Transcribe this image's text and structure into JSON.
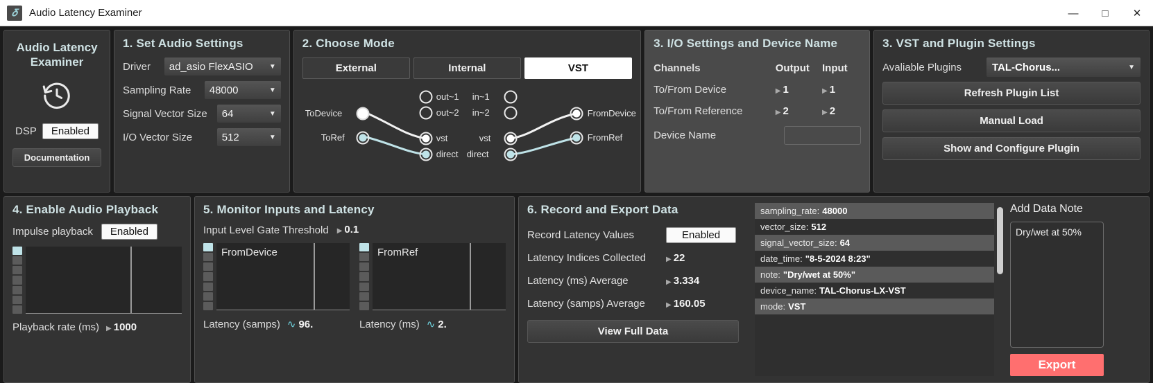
{
  "window": {
    "title": "Audio Latency Examiner",
    "icon": "app-icon",
    "minimize": "—",
    "maximize": "□",
    "close": "✕"
  },
  "brand": {
    "title": "Audio Latency Examiner",
    "icon": "history-clock-icon",
    "dsp_label": "DSP",
    "dsp_value": "Enabled",
    "documentation": "Documentation"
  },
  "audio_settings": {
    "title": "1. Set Audio Settings",
    "rows": [
      {
        "label": "Driver",
        "value": "ad_asio FlexASIO"
      },
      {
        "label": "Sampling Rate",
        "value": "48000"
      },
      {
        "label": "Signal Vector Size",
        "value": "64"
      },
      {
        "label": "I/O Vector Size",
        "value": "512"
      }
    ]
  },
  "mode": {
    "title": "2. Choose Mode",
    "buttons": [
      {
        "label": "External",
        "active": false
      },
      {
        "label": "Internal",
        "active": false
      },
      {
        "label": "VST",
        "active": true
      }
    ],
    "routing": {
      "left_nodes": [
        {
          "label": "ToDevice",
          "filled": "white"
        },
        {
          "label": "ToRef",
          "filled": "cyan"
        }
      ],
      "out_nodes": [
        {
          "label": "out~1",
          "filled": "none"
        },
        {
          "label": "out~2",
          "filled": "none"
        },
        {
          "label": "vst",
          "filled": "white"
        },
        {
          "label": "direct",
          "filled": "cyan"
        }
      ],
      "in_nodes": [
        {
          "label": "in~1",
          "filled": "none"
        },
        {
          "label": "in~2",
          "filled": "none"
        },
        {
          "label": "vst",
          "filled": "white"
        },
        {
          "label": "direct",
          "filled": "cyan"
        }
      ],
      "right_nodes": [
        {
          "label": "FromDevice",
          "filled": "white"
        },
        {
          "label": "FromRef",
          "filled": "cyan"
        }
      ]
    }
  },
  "io_settings": {
    "title": "3. I/O Settings and Device Name",
    "headers": {
      "channels": "Channels",
      "output": "Output",
      "input": "Input"
    },
    "rows": [
      {
        "label": "To/From Device",
        "output": "1",
        "input": "1"
      },
      {
        "label": "To/From Reference",
        "output": "2",
        "input": "2"
      }
    ],
    "device_name_label": "Device Name",
    "device_name_value": ""
  },
  "vst_settings": {
    "title": "3. VST and Plugin Settings",
    "plugins_label": "Avaliable Plugins",
    "plugins_value": "TAL-Chorus...",
    "buttons": [
      "Refresh Plugin List",
      "Manual Load",
      "Show and Configure Plugin"
    ]
  },
  "playback": {
    "title": "4. Enable Audio Playback",
    "impulse_label": "Impulse playback",
    "impulse_value": "Enabled",
    "rate_label": "Playback rate (ms)",
    "rate_value": "1000"
  },
  "monitor": {
    "title": "5. Monitor Inputs and Latency",
    "gate_label": "Input Level Gate Threshold",
    "gate_value": "0.1",
    "scopes": [
      {
        "name": "FromDevice",
        "foot_label": "Latency (samps)",
        "foot_value": "96."
      },
      {
        "name": "FromRef",
        "foot_label": "Latency (ms)",
        "foot_value": "2."
      }
    ]
  },
  "record": {
    "title": "6. Record and Export Data",
    "rows": [
      {
        "label": "Record Latency Values",
        "value": "Enabled",
        "type": "toggle"
      },
      {
        "label": "Latency Indices Collected",
        "value": "22",
        "type": "number"
      },
      {
        "label": "Latency (ms) Average",
        "value": "3.334",
        "type": "number"
      },
      {
        "label": "Latency (samps) Average",
        "value": "160.05",
        "type": "number"
      }
    ],
    "view_full_data": "View Full Data",
    "data_list": [
      {
        "key": "sampling_rate:",
        "value": "48000"
      },
      {
        "key": "vector_size:",
        "value": "512"
      },
      {
        "key": "signal_vector_size:",
        "value": "64"
      },
      {
        "key": "date_time:",
        "value": "\"8-5-2024 8:23\""
      },
      {
        "key": "note:",
        "value": "\"Dry/wet at 50%\""
      },
      {
        "key": "device_name:",
        "value": "TAL-Chorus-LX-VST"
      },
      {
        "key": "mode:",
        "value": "VST"
      }
    ],
    "note_title": "Add Data Note",
    "note_value": "Dry/wet at 50%",
    "export_label": "Export"
  },
  "colors": {
    "accent_title": "#cfe2e4",
    "cyan_node": "#bfe3e8",
    "export_red": "#ff6f6f",
    "panel_bg": "#333333",
    "panel_bg_light": "#4a4a4a"
  }
}
